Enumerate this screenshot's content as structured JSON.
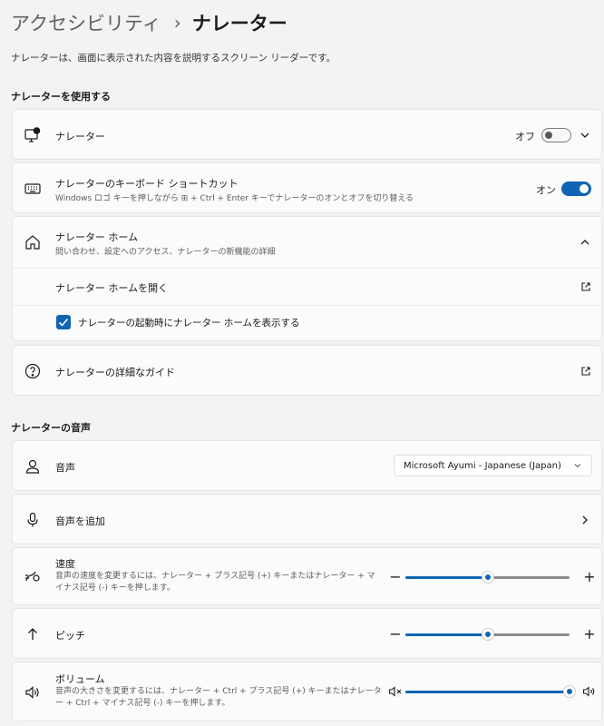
{
  "breadcrumb": {
    "parent": "アクセシビリティ",
    "separator": "›",
    "current": "ナレーター"
  },
  "page_description": "ナレーターは、画面に表示された内容を説明するスクリーン リーダーです。",
  "sections": {
    "use": "ナレーターを使用する",
    "voice": "ナレーターの音声"
  },
  "narrator": {
    "label": "ナレーター",
    "state_text": "オフ",
    "enabled": false,
    "icon": "narrator-monitor-icon"
  },
  "shortcut": {
    "label": "ナレーターのキーボード ショートカット",
    "description": "Windows ロゴ キーを押しながら ⊞ + Ctrl + Enter キーでナレーターのオンとオフを切り替える",
    "state_text": "オン",
    "enabled": true,
    "icon": "keyboard-icon"
  },
  "narrator_home": {
    "label": "ナレーター ホーム",
    "description": "問い合わせ、設定へのアクセス、ナレーターの新機能の詳細",
    "icon": "home-icon",
    "open_label": "ナレーター ホームを開く",
    "startup_checkbox_label": "ナレーターの起動時にナレーター ホームを表示する",
    "startup_checked": true
  },
  "guide": {
    "label": "ナレーターの詳細なガイド",
    "icon": "help-circle-icon"
  },
  "voice": {
    "label": "音声",
    "icon": "person-icon",
    "selected": "Microsoft Ayumi - Japanese (Japan)"
  },
  "add_voice": {
    "label": "音声を追加",
    "icon": "microphone-icon"
  },
  "speed": {
    "label": "速度",
    "description": "音声の速度を変更するには、ナレーター + プラス記号 (+) キーまたはナレーター + マイナス記号 (-) キーを押します。",
    "icon": "speed-icon",
    "value_fraction": 0.5,
    "minus": "−",
    "plus": "+"
  },
  "pitch": {
    "label": "ピッチ",
    "icon": "arrow-up-icon",
    "value_fraction": 0.5,
    "minus": "−",
    "plus": "+"
  },
  "volume": {
    "label": "ボリューム",
    "description": "音声の大きさを変更するには、ナレーター + Ctrl + プラス記号 (+) キーまたはナレーター + Ctrl + マイナス記号 (-) キーを押します。",
    "icon": "speaker-icon",
    "value_fraction": 1.0
  },
  "colors": {
    "accent": "#0f64b3",
    "background": "#f3f3f3",
    "card": "#fbfbfb"
  }
}
